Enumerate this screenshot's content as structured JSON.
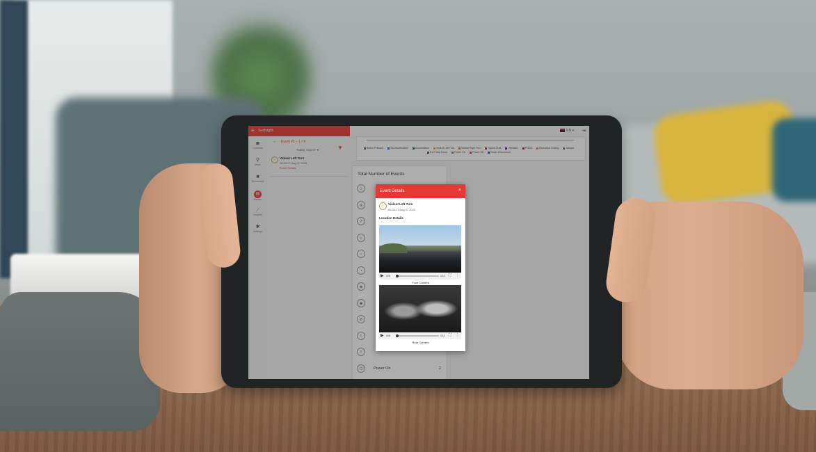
{
  "app": {
    "title": "Surfsight",
    "language": "EN"
  },
  "sidebar": {
    "items": [
      {
        "label": "Cameras",
        "icon": "camera-icon"
      },
      {
        "label": "Maps",
        "icon": "map-pin-icon"
      },
      {
        "label": "Recordings",
        "icon": "video-icon"
      },
      {
        "label": "Events",
        "icon": "events-icon",
        "active": true
      },
      {
        "label": "Insights",
        "icon": "chart-line-icon"
      },
      {
        "label": "Settings",
        "icon": "gear-icon"
      }
    ]
  },
  "event_list": {
    "back_label": "Event #1 – 1 / 4",
    "date_label": "Today, Aug 07",
    "events": [
      {
        "title": "Violent Left Turn",
        "time": "06:33:17 Aug 07 2020",
        "link": "Event Details"
      }
    ]
  },
  "chart": {
    "legend": [
      {
        "name": "Button Pressed",
        "color": "#2e7d32"
      },
      {
        "name": "Sio Acceleration",
        "color": "#1565c0"
      },
      {
        "name": "Acceleration",
        "color": "#00695c"
      },
      {
        "name": "Violent Left Turn",
        "color": "#f9a825"
      },
      {
        "name": "Violent Right Turn",
        "color": "#ef6c00"
      },
      {
        "name": "Speed Limit",
        "color": "#c62828"
      },
      {
        "name": "Vibration",
        "color": "#6a1b9a"
      },
      {
        "name": "Prolon",
        "color": "#ad1457"
      },
      {
        "name": "Distracted Driving",
        "color": "#ff7043"
      },
      {
        "name": "Tamper",
        "color": "#8d6e63"
      },
      {
        "name": "Ext Party Event",
        "color": "#455a64"
      },
      {
        "name": "Power On",
        "color": "#43a047"
      },
      {
        "name": "Power Off",
        "color": "#e53935"
      },
      {
        "name": "Power Disconnect",
        "color": "#3949ab"
      }
    ]
  },
  "totals": {
    "title": "Total Number of Events",
    "rows": [
      {
        "label": "",
        "count": "",
        "icon": "driver-icon"
      },
      {
        "label": "",
        "count": "",
        "icon": "speed-icon"
      },
      {
        "label": "",
        "count": "",
        "icon": "acceleration-icon"
      },
      {
        "label": "",
        "count": "",
        "icon": "left-turn-icon"
      },
      {
        "label": "",
        "count": "",
        "icon": "right-turn-icon"
      },
      {
        "label": "",
        "count": "",
        "icon": "speedometer-icon"
      },
      {
        "label": "",
        "count": "",
        "icon": "vibration-icon"
      },
      {
        "label": "",
        "count": "",
        "icon": "face-icon"
      },
      {
        "label": "",
        "count": "",
        "icon": "distracted-icon"
      },
      {
        "label": "",
        "count": "",
        "icon": "tamper-icon"
      },
      {
        "label": "",
        "count": "",
        "icon": "alert-icon"
      },
      {
        "label": "Power On",
        "count": "2",
        "icon": "power-on-icon"
      }
    ]
  },
  "modal": {
    "title": "Event Details",
    "close_symbol": "×",
    "event_title": "Violent Left Turn",
    "event_time": "06:33:17 Aug 07 2020",
    "location_title": "Location Details",
    "location_address": "...................................................",
    "front_caption": "Front Camera",
    "rear_caption": "Rear Camera",
    "front_video": {
      "current": "0:00",
      "duration": "0:13"
    },
    "rear_video": {
      "current": "0:00",
      "duration": "0:13"
    }
  }
}
